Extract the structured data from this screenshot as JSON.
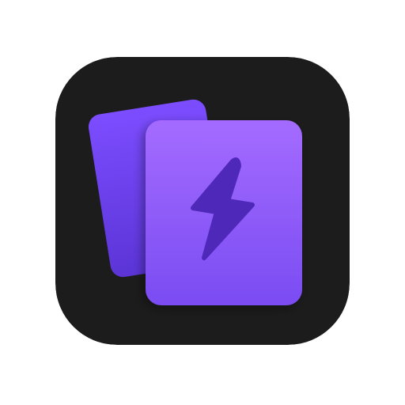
{
  "app_icon": {
    "icon": "flash-cards-icon",
    "colors": {
      "background": "#1c1c1c",
      "back_card_top": "#7c4dff",
      "back_card_bottom": "#5b34d6",
      "front_card_top": "#a46bff",
      "front_card_bottom": "#7a4cf2",
      "bolt": "#4e28b8"
    }
  }
}
